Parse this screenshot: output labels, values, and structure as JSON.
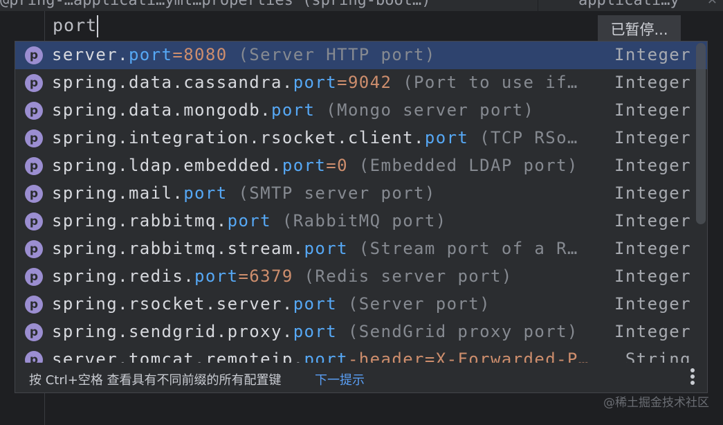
{
  "tabbar": {
    "visible_fragment": "@pring-…applicati…yml…properties (spring-boot…)",
    "tab2_fragment": "applicati…y"
  },
  "editor": {
    "typed_text": "port",
    "paused_label": "已暂停..."
  },
  "completion": {
    "items": [
      {
        "prefix": "server.",
        "match": "port",
        "value": "=8080",
        "desc": " (Server HTTP port)",
        "type": "Integer",
        "selected": true
      },
      {
        "prefix": "spring.data.cassandra.",
        "match": "port",
        "value": "=9042",
        "desc": " (Port to use if…",
        "type": "Integer"
      },
      {
        "prefix": "spring.data.mongodb.",
        "match": "port",
        "value": "",
        "desc": " (Mongo server port)",
        "type": "Integer"
      },
      {
        "prefix": "spring.integration.rsocket.client.",
        "match": "port",
        "value": "",
        "desc": " (TCP RSo…",
        "type": "Integer"
      },
      {
        "prefix": "spring.ldap.embedded.",
        "match": "port",
        "value": "=0",
        "desc": " (Embedded LDAP port)",
        "type": "Integer"
      },
      {
        "prefix": "spring.mail.",
        "match": "port",
        "value": "",
        "desc": " (SMTP server port)",
        "type": "Integer"
      },
      {
        "prefix": "spring.rabbitmq.",
        "match": "port",
        "value": "",
        "desc": " (RabbitMQ port)",
        "type": "Integer"
      },
      {
        "prefix": "spring.rabbitmq.stream.",
        "match": "port",
        "value": "",
        "desc": " (Stream port of a R…",
        "type": "Integer"
      },
      {
        "prefix": "spring.redis.",
        "match": "port",
        "value": "=6379",
        "desc": " (Redis server port)",
        "type": "Integer"
      },
      {
        "prefix": "spring.rsocket.server.",
        "match": "port",
        "value": "",
        "desc": " (Server port)",
        "type": "Integer"
      },
      {
        "prefix": "spring.sendgrid.proxy.",
        "match": "port",
        "value": "",
        "desc": " (SendGrid proxy port)",
        "type": "Integer"
      },
      {
        "prefix": "server.tomcat.remoteip.",
        "match": "port",
        "value": "-header=X-Forwarded-P…",
        "desc": "",
        "type": "String"
      }
    ],
    "icon_letter": "p",
    "footer_hint": "按 Ctrl+空格 查看具有不同前缀的所有配置键",
    "footer_link": "下一提示"
  },
  "watermark": "@稀土掘金技术社区",
  "icons": {
    "item": "property-p-icon",
    "more": "more-vertical-icon",
    "close": "close-icon"
  },
  "colors": {
    "background": "#1e1f22",
    "popup": "#2b2d30",
    "selected_row": "#2e436e",
    "match_highlight": "#56a8f5",
    "value": "#ce8e6d",
    "icon": "#9b8ed1"
  }
}
